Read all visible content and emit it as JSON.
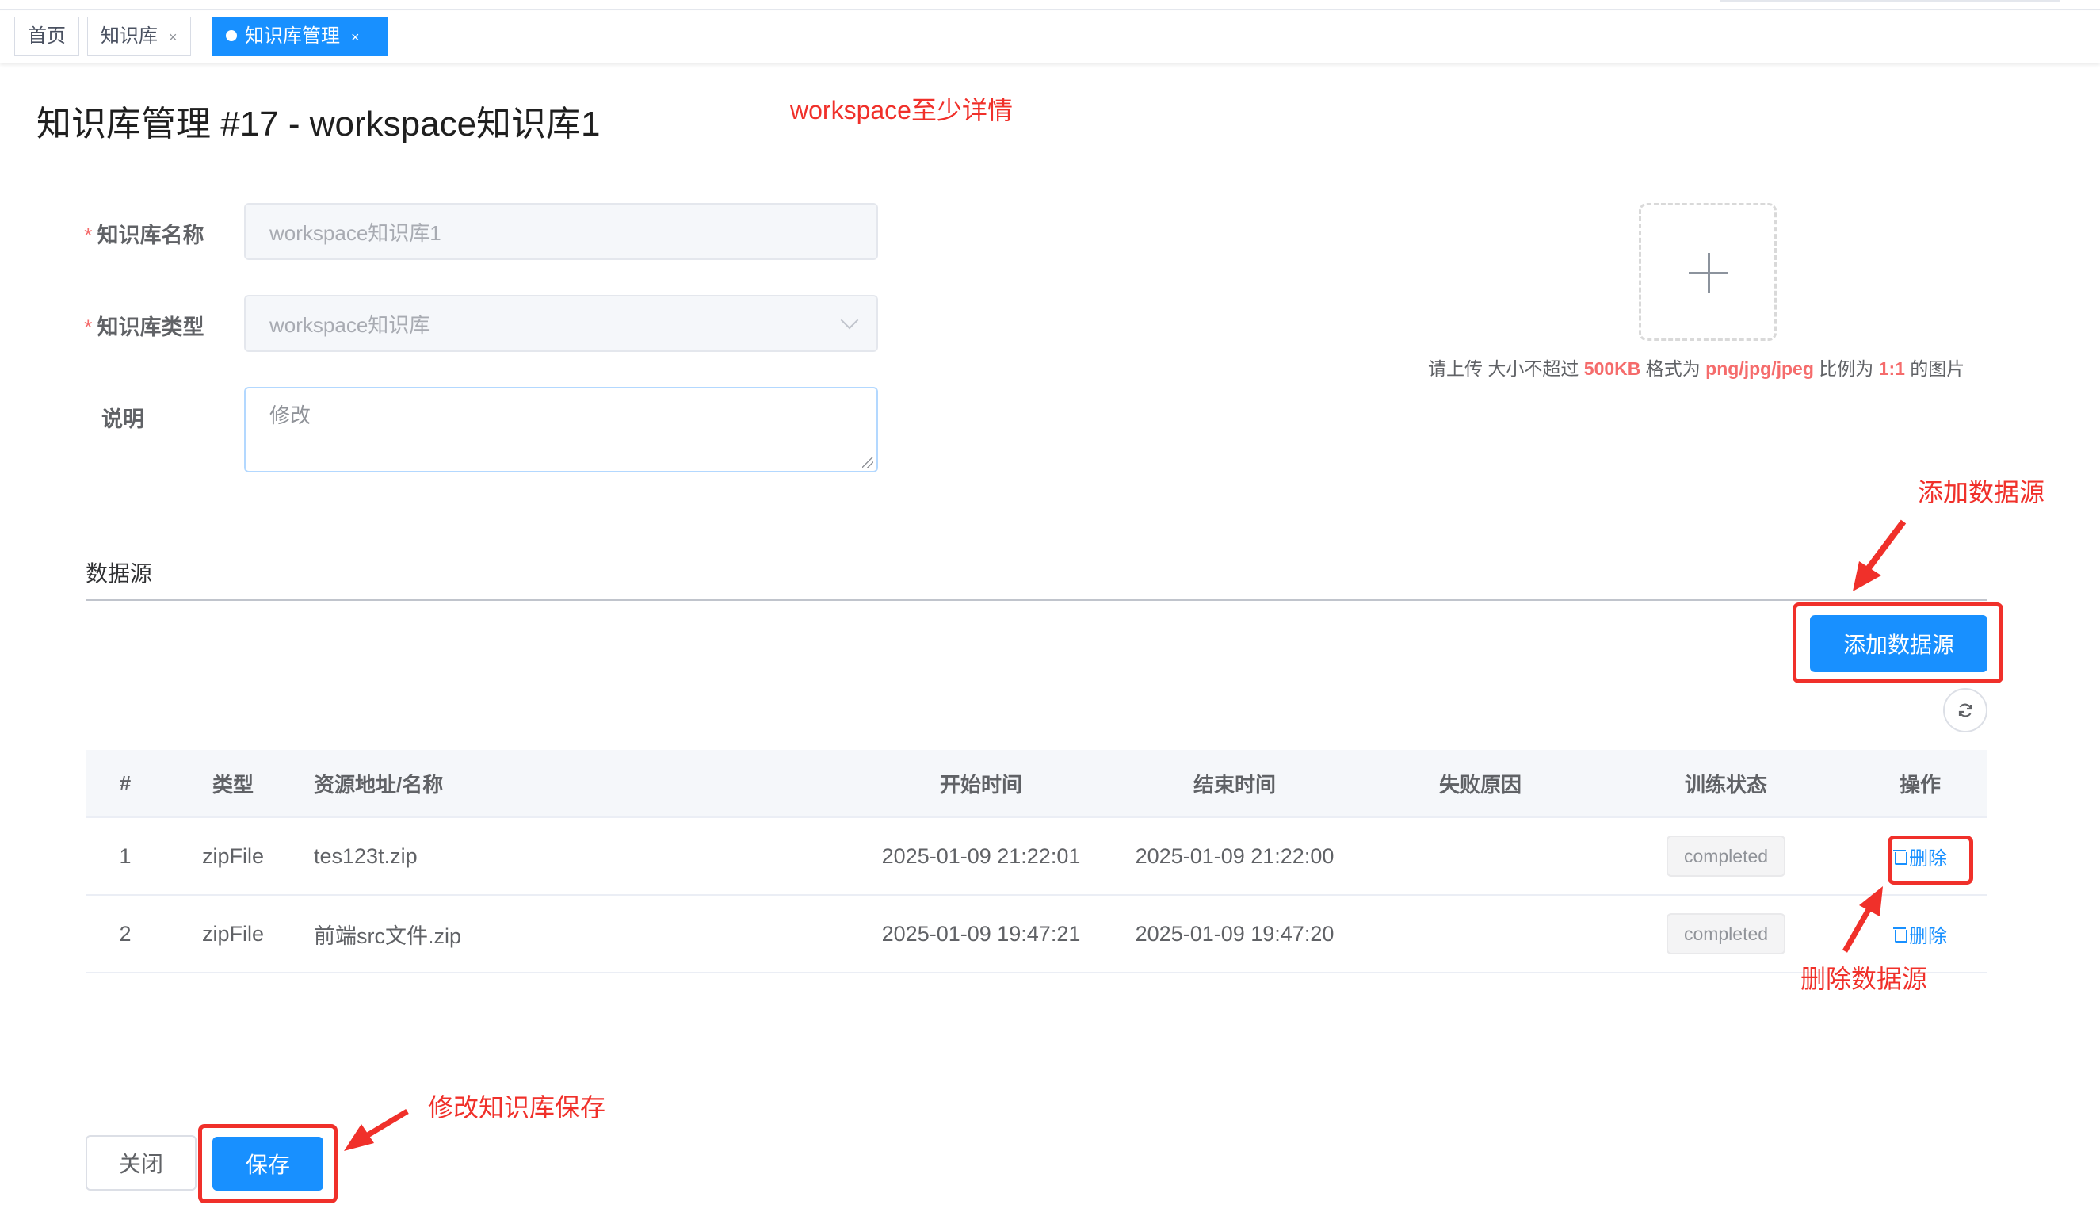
{
  "tabs": [
    {
      "label": "首页",
      "closable": false,
      "active": false
    },
    {
      "label": "知识库",
      "closable": true,
      "active": false
    },
    {
      "label": "知识库管理",
      "closable": true,
      "active": true
    }
  ],
  "tab_close_glyph": "×",
  "page_title": "知识库管理 #17 - workspace知识库1",
  "annotations": {
    "detail": "workspace至少详情",
    "add_source": "添加数据源",
    "delete_source": "删除数据源",
    "save_edit": "修改知识库保存"
  },
  "form": {
    "name_label": "知识库名称",
    "name_value": "workspace知识库1",
    "type_label": "知识库类型",
    "type_value": "workspace知识库",
    "desc_label": "说明",
    "desc_value": "修改",
    "required_mark": "*"
  },
  "upload": {
    "tip_prefix": "请上传 大小不超过 ",
    "size": "500KB",
    "tip_mid": " 格式为 ",
    "formats": "png/jpg/jpeg",
    "tip_mid2": " 比例为 ",
    "ratio": "1:1",
    "tip_suffix": " 的图片"
  },
  "datasource": {
    "section_title": "数据源",
    "add_button": "添加数据源",
    "columns": [
      "#",
      "类型",
      "资源地址/名称",
      "开始时间",
      "结束时间",
      "失败原因",
      "训练状态",
      "操作"
    ],
    "rows": [
      {
        "num": "1",
        "type": "zipFile",
        "resource": "tes123t.zip",
        "start": "2025-01-09 21:22:01",
        "end": "2025-01-09 21:22:00",
        "fail": "",
        "status": "completed",
        "op": "删除"
      },
      {
        "num": "2",
        "type": "zipFile",
        "resource": "前端src文件.zip",
        "start": "2025-01-09 19:47:21",
        "end": "2025-01-09 19:47:20",
        "fail": "",
        "status": "completed",
        "op": "删除"
      }
    ]
  },
  "footer": {
    "close_button": "关闭",
    "save_button": "保存"
  },
  "colors": {
    "primary": "#1890ff",
    "annotation": "#f0302a"
  },
  "icons": [
    "plus-icon",
    "chevron-down-icon",
    "refresh-icon",
    "trash-icon",
    "arrow-icon"
  ]
}
